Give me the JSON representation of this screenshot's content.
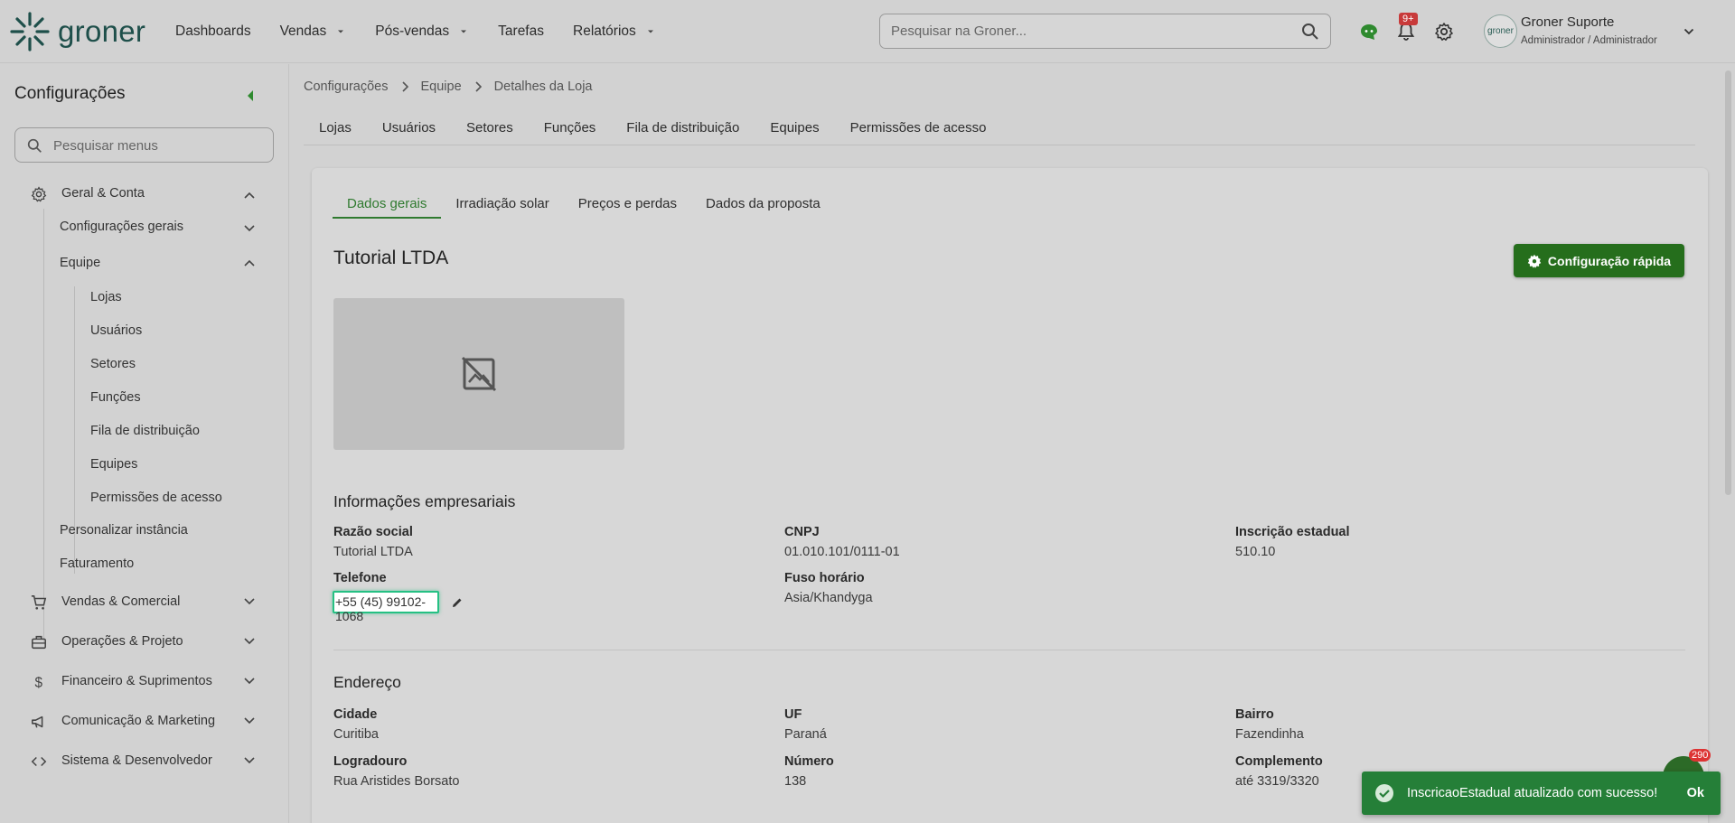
{
  "brand": {
    "name": "groner",
    "color": "#1e4f4a",
    "accent": "#2f7a2f"
  },
  "nav": [
    {
      "label": "Dashboards",
      "dropdown": false
    },
    {
      "label": "Vendas",
      "dropdown": true
    },
    {
      "label": "Pós-vendas",
      "dropdown": true
    },
    {
      "label": "Tarefas",
      "dropdown": false
    },
    {
      "label": "Relatórios",
      "dropdown": true
    }
  ],
  "search": {
    "placeholder": "Pesquisar na Groner..."
  },
  "notifications": {
    "badge": "9+"
  },
  "user": {
    "name": "Groner Suporte",
    "role": "Administrador / Administrador",
    "avatar_text": "groner"
  },
  "sidebar": {
    "title": "Configurações",
    "search_placeholder": "Pesquisar menus",
    "groups": [
      {
        "label": "Geral & Conta",
        "icon": "gear-icon"
      },
      {
        "label": "Configurações gerais"
      },
      {
        "label": "Equipe"
      },
      {
        "label": "Lojas"
      },
      {
        "label": "Usuários"
      },
      {
        "label": "Setores"
      },
      {
        "label": "Funções"
      },
      {
        "label": "Fila de distribuição"
      },
      {
        "label": "Equipes"
      },
      {
        "label": "Permissões de acesso"
      },
      {
        "label": "Personalizar instância"
      },
      {
        "label": "Faturamento"
      },
      {
        "label": "Vendas & Comercial",
        "icon": "cart-icon"
      },
      {
        "label": "Operações & Projeto",
        "icon": "toolbox-icon"
      },
      {
        "label": "Financeiro & Suprimentos",
        "icon": "dollar-icon"
      },
      {
        "label": "Comunicação & Marketing",
        "icon": "megaphone-icon"
      },
      {
        "label": "Sistema & Desenvolvedor",
        "icon": "code-icon"
      }
    ]
  },
  "breadcrumb": [
    "Configurações",
    "Equipe",
    "Detalhes da Loja"
  ],
  "tabs": [
    "Lojas",
    "Usuários",
    "Setores",
    "Funções",
    "Fila de distribuição",
    "Equipes",
    "Permissões de acesso"
  ],
  "card": {
    "tabs": [
      "Dados gerais",
      "Irradiação solar",
      "Preços e perdas",
      "Dados da proposta"
    ],
    "active_tab": "Dados gerais",
    "company": "Tutorial LTDA",
    "quick_config": "Configuração rápida",
    "business_section": "Informações empresariais",
    "fields": {
      "razao_social": {
        "label": "Razão social",
        "value": "Tutorial LTDA"
      },
      "cnpj": {
        "label": "CNPJ",
        "value": "01.010.101/0111-01"
      },
      "inscricao": {
        "label": "Inscrição estadual",
        "value": "510.10"
      },
      "telefone": {
        "label": "Telefone",
        "value": "+55 (45) 99102-1068"
      },
      "fuso": {
        "label": "Fuso horário",
        "value": "Asia/Khandyga"
      }
    },
    "address_section": "Endereço",
    "address": {
      "cidade": {
        "label": "Cidade",
        "value": "Curitiba"
      },
      "uf": {
        "label": "UF",
        "value": "Paraná"
      },
      "bairro": {
        "label": "Bairro",
        "value": "Fazendinha"
      },
      "logradouro": {
        "label": "Logradouro",
        "value": "Rua Aristides Borsato"
      },
      "numero": {
        "label": "Número",
        "value": "138"
      },
      "complemento": {
        "label": "Complemento",
        "value": "até 3319/3320"
      }
    }
  },
  "chat": {
    "badge": "290"
  },
  "toast": {
    "message": "InscricaoEstadual atualizado com sucesso!",
    "action": "Ok",
    "color": "#257f38"
  }
}
